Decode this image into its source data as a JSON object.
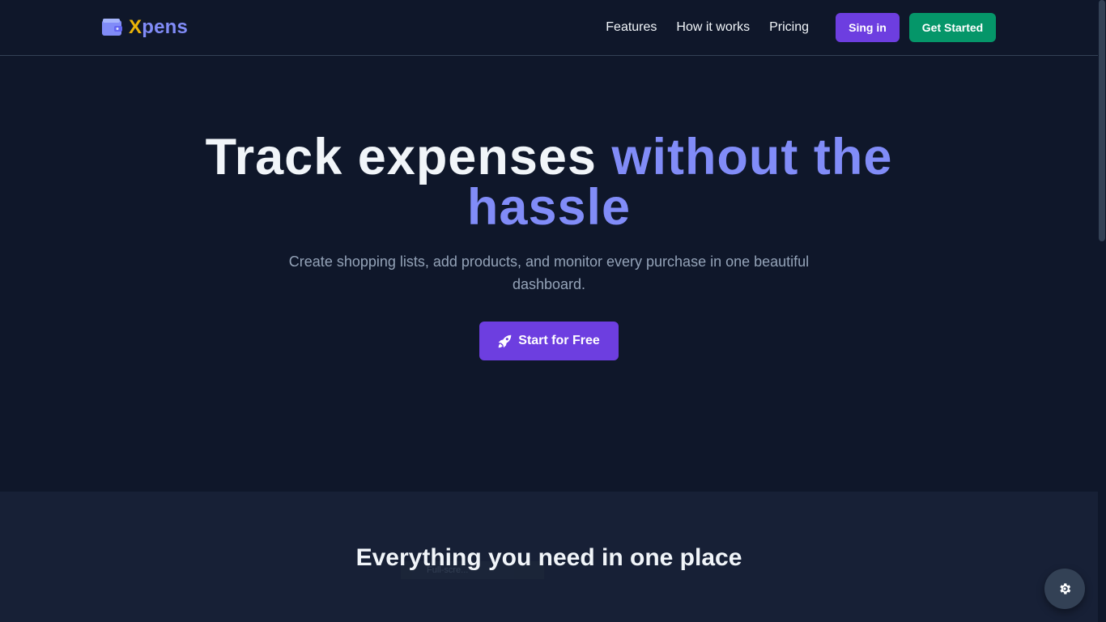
{
  "brand": {
    "x": "X",
    "rest": "pens"
  },
  "nav": {
    "links": [
      "Features",
      "How it works",
      "Pricing"
    ],
    "signin_label": "Sing in",
    "get_started_label": "Get Started"
  },
  "hero": {
    "title_main": "Track expenses ",
    "title_accent": "without the hassle",
    "subtitle": "Create shopping lists, add products, and monitor every purchase in one beautiful dashboard.",
    "cta_label": "Start for Free"
  },
  "features": {
    "title": "Everything you need in one place",
    "ghost_badge": "Full-scre..."
  },
  "colors": {
    "background": "#0f172a",
    "accent": "#818cf8",
    "brand_x": "#eab308",
    "primary_button": "#6d3ee0",
    "success_button": "#059669"
  },
  "icons": {
    "logo": "wallet-icon",
    "cta": "rocket-icon",
    "settings": "gear-icon"
  }
}
